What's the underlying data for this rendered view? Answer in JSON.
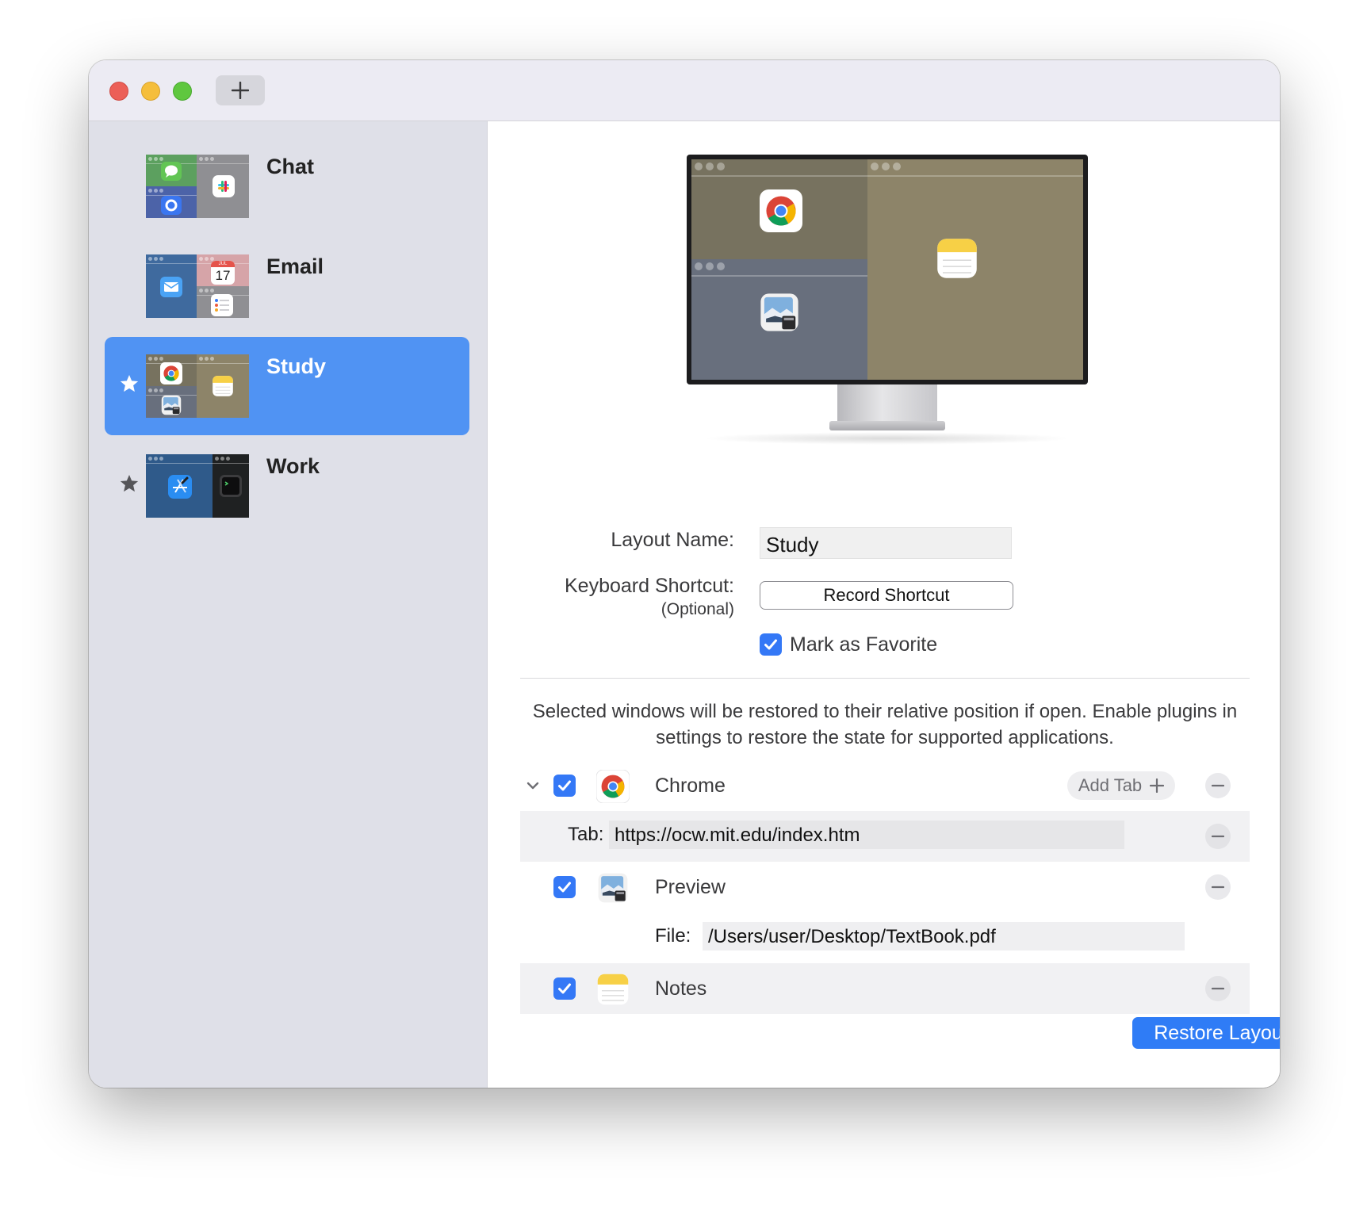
{
  "window": {
    "add_label": "+"
  },
  "sidebar": {
    "items": [
      {
        "name": "Chat",
        "favorite": false,
        "selected": false
      },
      {
        "name": "Email",
        "favorite": false,
        "selected": false
      },
      {
        "name": "Study",
        "favorite": true,
        "selected": true
      },
      {
        "name": "Work",
        "favorite": true,
        "selected": false
      }
    ]
  },
  "email_thumb": {
    "calendar_month": "JUL",
    "calendar_day": "17"
  },
  "form": {
    "layout_name_label": "Layout Name:",
    "layout_name_value": "Study",
    "shortcut_label": "Keyboard Shortcut:",
    "shortcut_optional": "(Optional)",
    "record_shortcut": "Record Shortcut",
    "favorite_label": "Mark as Favorite",
    "favorite_checked": true
  },
  "description": "Selected windows will be restored to their relative position if open. Enable plugins in settings to restore the state for supported applications.",
  "windows": {
    "chrome": {
      "name": "Chrome",
      "checked": true,
      "expanded": true,
      "add_tab_label": "Add Tab",
      "tab_label": "Tab:",
      "tab_url": "https://ocw.mit.edu/index.htm"
    },
    "preview": {
      "name": "Preview",
      "checked": true,
      "file_label": "File:",
      "file_path": "/Users/user/Desktop/TextBook.pdf"
    },
    "notes": {
      "name": "Notes",
      "checked": true
    }
  },
  "restore_button": "Restore Layout",
  "colors": {
    "accent": "#3478f6",
    "selection": "#5093f3",
    "sidebar_bg": "#dfe0e8",
    "close": "#ec5f57",
    "minimize": "#f5be3b",
    "zoom": "#5fc73f"
  },
  "icons": {
    "close": "close-traffic-light",
    "minimize": "minimize-traffic-light",
    "zoom": "zoom-traffic-light",
    "favorite": "star-icon",
    "expand": "chevron-down-icon",
    "remove": "minus-icon"
  }
}
